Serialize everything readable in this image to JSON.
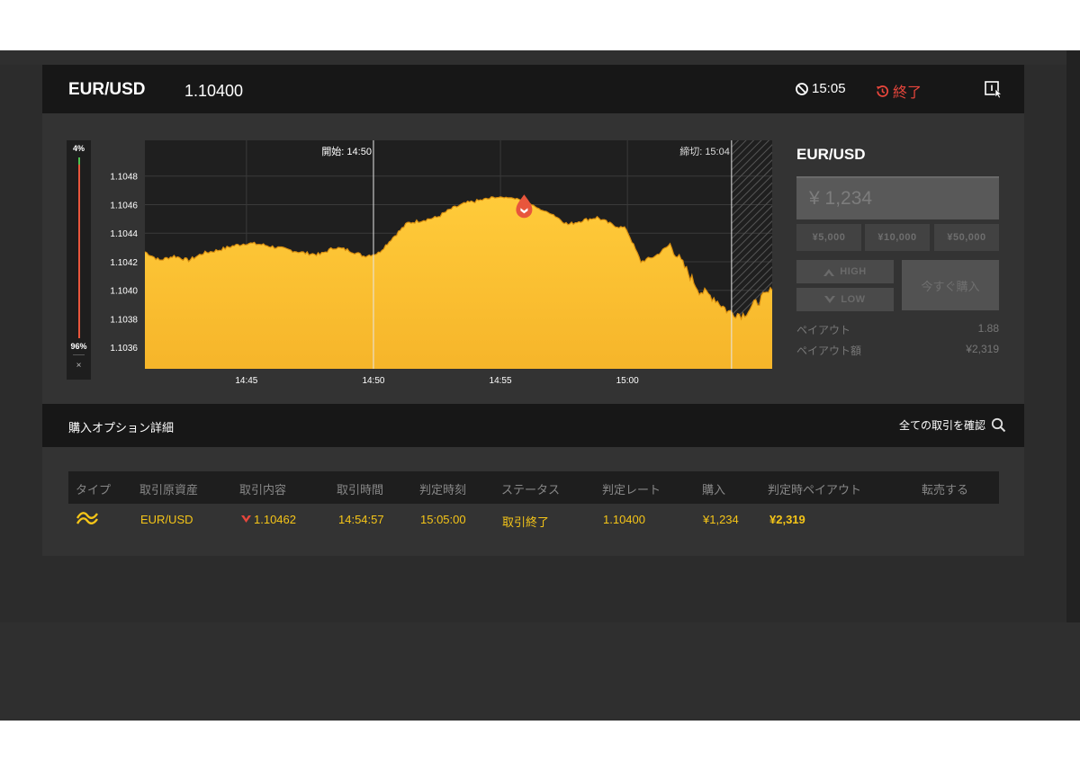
{
  "header": {
    "pair": "EUR/USD",
    "rate": "1.10400",
    "timer": "15:05",
    "status": "終了"
  },
  "sentiment": {
    "top_percent": "4%",
    "bottom_percent": "96%",
    "close": "×"
  },
  "chart_data": {
    "type": "area",
    "y_ticks": [
      "1.1048",
      "1.1046",
      "1.1044",
      "1.1042",
      "1.1040",
      "1.1038",
      "1.1036"
    ],
    "x_ticks": [
      "14:45",
      "14:50",
      "14:55",
      "15:00"
    ],
    "ylim": [
      1.10345,
      1.10505
    ],
    "start_label": "開始: 14:50",
    "deadline_label": "締切: 15:04",
    "series_color": "#f7b32b",
    "points": [
      [
        0,
        1.10427
      ],
      [
        1,
        1.10421
      ],
      [
        2,
        1.10424
      ],
      [
        3,
        1.10421
      ],
      [
        4,
        1.10426
      ],
      [
        5,
        1.10428
      ],
      [
        6,
        1.10431
      ],
      [
        7,
        1.10433
      ],
      [
        8,
        1.10432
      ],
      [
        9,
        1.1043
      ],
      [
        10,
        1.10428
      ],
      [
        11,
        1.10426
      ],
      [
        12,
        1.10425
      ],
      [
        13,
        1.1043
      ],
      [
        14,
        1.10428
      ],
      [
        15,
        1.10424
      ],
      [
        16,
        1.10426
      ],
      [
        17,
        1.10437
      ],
      [
        18,
        1.10447
      ],
      [
        19,
        1.10449
      ],
      [
        20,
        1.10451
      ],
      [
        21,
        1.10457
      ],
      [
        22,
        1.10461
      ],
      [
        23,
        1.10463
      ],
      [
        24,
        1.10465
      ],
      [
        25,
        1.10465
      ],
      [
        26,
        1.10463
      ],
      [
        27,
        1.10457
      ],
      [
        28,
        1.10453
      ],
      [
        29,
        1.10446
      ],
      [
        30,
        1.10449
      ],
      [
        31,
        1.10451
      ],
      [
        32,
        1.10446
      ],
      [
        33,
        1.10443
      ],
      [
        34,
        1.1042
      ],
      [
        35,
        1.10424
      ],
      [
        36,
        1.10432
      ],
      [
        37,
        1.10416
      ],
      [
        38,
        1.104
      ],
      [
        39,
        1.10395
      ],
      [
        40,
        1.10385
      ],
      [
        41,
        1.10383
      ],
      [
        42,
        1.10392
      ],
      [
        43,
        1.104
      ]
    ],
    "trade_marker": {
      "x": 26,
      "y": 1.10462
    }
  },
  "trade_panel": {
    "pair": "EUR/USD",
    "amount_placeholder": "¥ 1,234",
    "presets": [
      "¥5,000",
      "¥10,000",
      "¥50,000"
    ],
    "high_label": "HIGH",
    "low_label": "LOW",
    "buy_now_label": "今すぐ購入",
    "payout_label": "ペイアウト",
    "payout_value": "1.88",
    "payout_amount_label": "ペイアウト額",
    "payout_amount_value": "¥2,319"
  },
  "options": {
    "title": "購入オプション詳細",
    "view_all": "全ての取引を確認",
    "columns": [
      "タイプ",
      "取引原資産",
      "取引内容",
      "取引時間",
      "判定時刻",
      "ステータス",
      "判定レート",
      "購入",
      "判定時ペイアウト",
      "転売する"
    ],
    "row": {
      "asset": "EUR/USD",
      "content": "1.10462",
      "trade_time": "14:54:57",
      "judge_time": "15:05:00",
      "status": "取引終了",
      "judge_rate": "1.10400",
      "purchase": "¥1,234",
      "payout": "¥2,319"
    }
  },
  "colors": {
    "accent": "#f5c518",
    "danger": "#e8463c",
    "background": "#2c2c2c",
    "panel": "#333333"
  }
}
